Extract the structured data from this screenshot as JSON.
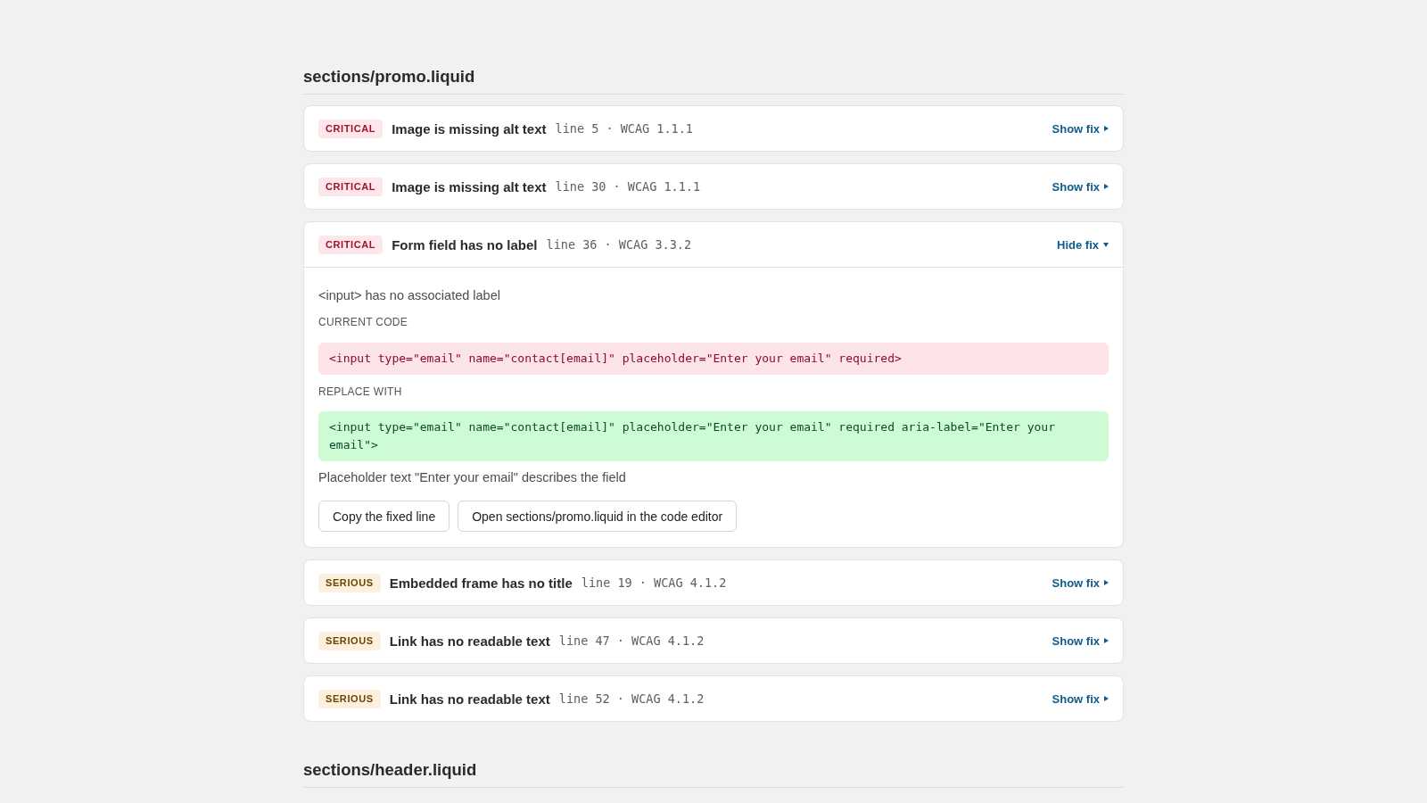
{
  "sections": [
    {
      "heading": "sections/promo.liquid",
      "issues": [
        {
          "kind": "critical",
          "badge": "CRITICAL",
          "title": "Image is missing alt text",
          "location": "line 5 · WCAG 1.1.1",
          "toggle": "Show fix",
          "expanded": false
        },
        {
          "kind": "critical",
          "badge": "CRITICAL",
          "title": "Image is missing alt text",
          "location": "line 30 · WCAG 1.1.1",
          "toggle": "Show fix",
          "expanded": false
        },
        {
          "kind": "critical",
          "badge": "CRITICAL",
          "title": "Form field has no label",
          "location": "line 36 · WCAG 3.3.2",
          "toggle": "Hide fix",
          "expanded": true,
          "detail": {
            "message": "<input> has no associated label",
            "current_label": "CURRENT CODE",
            "current_code": "<input type=\"email\" name=\"contact[email]\" placeholder=\"Enter your email\" required>",
            "replace_label": "REPLACE WITH",
            "replacement_code": "<input type=\"email\" name=\"contact[email]\" placeholder=\"Enter your email\" required aria-label=\"Enter your email\">",
            "note": "Placeholder text \"Enter your email\" describes the field",
            "actions": [
              "Copy the fixed line",
              "Open sections/promo.liquid in the code editor"
            ]
          }
        },
        {
          "kind": "serious",
          "badge": "SERIOUS",
          "title": "Embedded frame has no title",
          "location": "line 19 · WCAG 4.1.2",
          "toggle": "Show fix",
          "expanded": false
        },
        {
          "kind": "serious",
          "badge": "SERIOUS",
          "title": "Link has no readable text",
          "location": "line 47 · WCAG 4.1.2",
          "toggle": "Show fix",
          "expanded": false
        },
        {
          "kind": "serious",
          "badge": "SERIOUS",
          "title": "Link has no readable text",
          "location": "line 52 · WCAG 4.1.2",
          "toggle": "Show fix",
          "expanded": false
        }
      ]
    },
    {
      "heading": "sections/header.liquid"
    }
  ]
}
